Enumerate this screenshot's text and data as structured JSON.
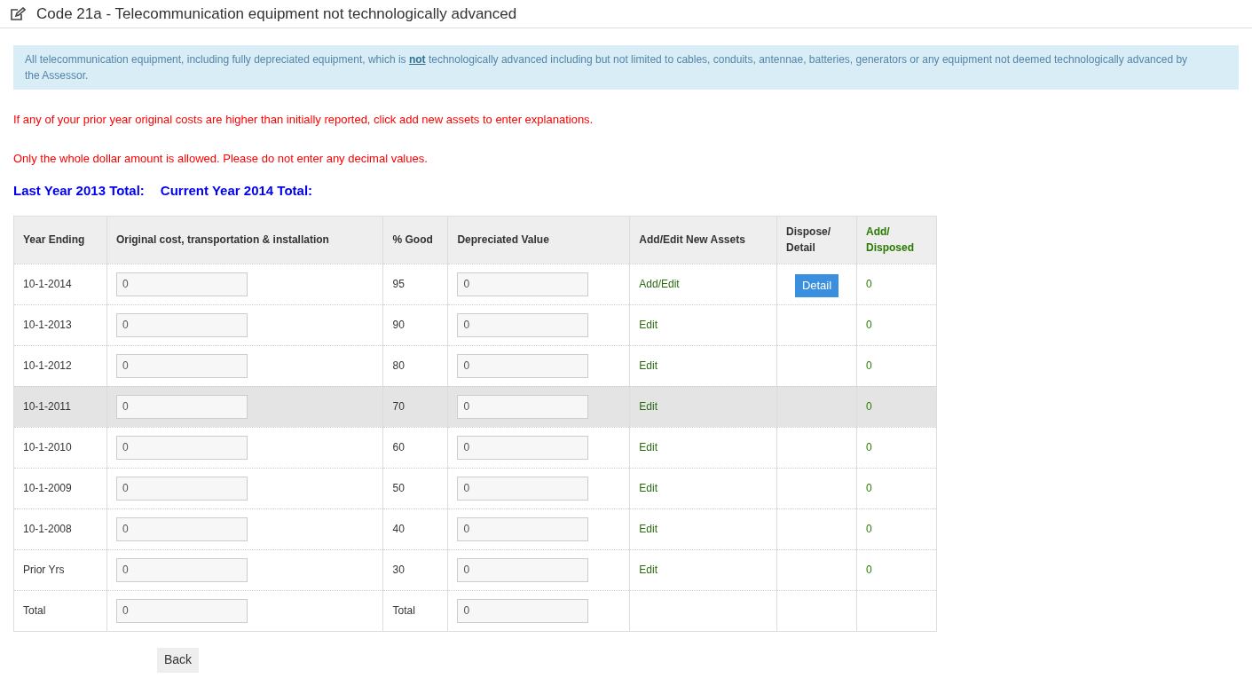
{
  "title": "Code 21a - Telecommunication equipment not technologically advanced",
  "info": "All telecommunication equipment, including fully depreciated equipment, which is **not** technologically advanced including but not limited to cables, conduits, antennae, batteries, generators or any equipment not deemed technologically advanced by the Assessor.",
  "notices": [
    "If any of your prior year original costs are higher than initially reported, click add new assets to enter explanations.",
    "Only the whole dollar amount is allowed. Please do not enter any decimal values."
  ],
  "totals": [
    "Last Year 2013 Total:",
    "Current Year 2014 Total:"
  ],
  "table": {
    "columns": [
      "Year Ending",
      "Original cost, transportation & installation",
      "% Good",
      "Depreciated Value",
      "Add/Edit New Assets",
      "Dispose/ Detail",
      "Add/ Disposed"
    ],
    "rows": [
      {
        "kind": "year",
        "year": "10-1-2014",
        "cost": "0",
        "good": "95",
        "value": "0",
        "action": "Add/Edit",
        "detail": "Detail",
        "disposed": "0",
        "highlighted": false
      },
      {
        "kind": "year",
        "year": "10-1-2013",
        "cost": "0",
        "good": "90",
        "value": "0",
        "action": "Edit",
        "disposed": "0",
        "highlighted": false
      },
      {
        "kind": "year",
        "year": "10-1-2012",
        "cost": "0",
        "good": "80",
        "value": "0",
        "action": "Edit",
        "disposed": "0",
        "highlighted": false
      },
      {
        "kind": "year",
        "year": "10-1-2011",
        "cost": "0",
        "good": "70",
        "value": "0",
        "action": "Edit",
        "disposed": "0",
        "highlighted": true
      },
      {
        "kind": "year",
        "year": "10-1-2010",
        "cost": "0",
        "good": "60",
        "value": "0",
        "action": "Edit",
        "disposed": "0",
        "highlighted": false
      },
      {
        "kind": "year",
        "year": "10-1-2009",
        "cost": "0",
        "good": "50",
        "value": "0",
        "action": "Edit",
        "disposed": "0",
        "highlighted": false
      },
      {
        "kind": "year",
        "year": "10-1-2008",
        "cost": "0",
        "good": "40",
        "value": "0",
        "action": "Edit",
        "disposed": "0",
        "highlighted": false
      },
      {
        "kind": "year",
        "year": "Prior Yrs",
        "cost": "0",
        "good": "30",
        "value": "0",
        "action": "Edit",
        "disposed": "0",
        "highlighted": false
      },
      {
        "kind": "total",
        "year": "Total",
        "cost": "0",
        "good": "Total",
        "value": "0"
      }
    ]
  },
  "back_button": "Back"
}
